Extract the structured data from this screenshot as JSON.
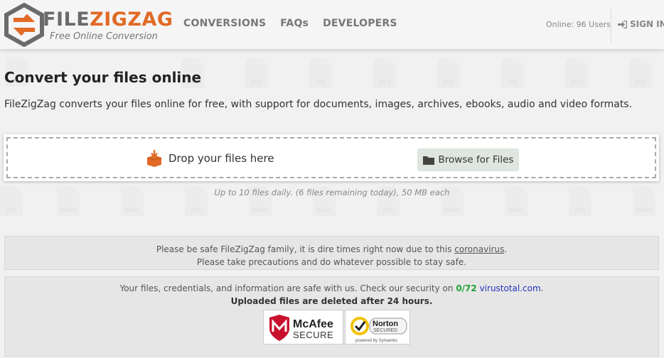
{
  "header": {
    "brand_part1": "FILE",
    "brand_part2": "ZIGZAG",
    "tagline": "Free Online Conversion",
    "nav": [
      "CONVERSIONS",
      "FAQs",
      "DEVELOPERS"
    ],
    "online_users": "Online: 96 Users",
    "sign_in": "SIGN IN"
  },
  "colors": {
    "brand_orange": "#e06a26",
    "brand_gray": "#6b6b6b",
    "scan_green": "#22a23a",
    "link_blue": "#2233bb"
  },
  "main": {
    "title": "Convert your files online",
    "description": "FileZigZag converts your files online for free, with support for documents, images, archives, ebooks, audio and video formats.",
    "drop_label": "Drop your files here",
    "browse_label": "Browse for Files",
    "limits": "Up to 10 files daily. (6 files remaining today), 50 MB each"
  },
  "background_file_types": [
    "PPT",
    "PDF",
    "GIF",
    "PPT",
    "PDF",
    "GIF",
    "PPT",
    "PDF",
    "WMV",
    "DOC",
    "JPG",
    "WMV",
    "DOC",
    "JPG",
    "WMV",
    "DOC",
    "JPG"
  ],
  "notice": {
    "line1_prefix": "Please be safe FileZigZag family, it is dire times right now due to this ",
    "line1_link": "coronavirus",
    "line1_suffix": ".",
    "line2": "Please take precautions and do whatever possible to stay safe."
  },
  "security": {
    "line1_prefix": "Your files, credentials, and information are safe with us. Check our security on ",
    "scan_result": "0/72",
    "scan_site": "virustotal.com",
    "line1_suffix": ".",
    "line2": "Uploaded files are deleted after 24 hours.",
    "mcafee_name": "McAfee",
    "mcafee_secure": "SECURE",
    "norton_name": "Norton",
    "norton_secured": "SECURED",
    "norton_powered": "powered by Symantec"
  },
  "icons": {
    "logo": "filezigzag-logo-icon",
    "sign_in": "sign-in-icon",
    "drop": "download-box-icon",
    "browse": "folder-icon"
  }
}
